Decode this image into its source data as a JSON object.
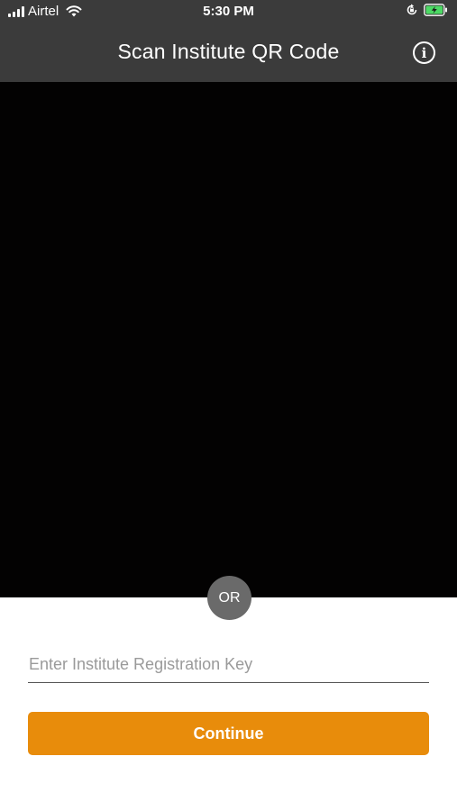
{
  "status_bar": {
    "carrier": "Airtel",
    "time": "5:30 PM",
    "icons": [
      "signal-icon",
      "wifi-icon",
      "orientation-lock-icon",
      "battery-charging-icon"
    ]
  },
  "header": {
    "title": "Scan Institute QR Code",
    "info_icon": "info-icon"
  },
  "divider": {
    "label": "OR"
  },
  "form": {
    "key_placeholder": "Enter Institute Registration Key",
    "key_value": "",
    "continue_label": "Continue"
  },
  "colors": {
    "header_bg": "#3b3b3b",
    "camera_bg": "#030202",
    "accent": "#e88c0b",
    "badge_bg": "#6a6a6a"
  }
}
